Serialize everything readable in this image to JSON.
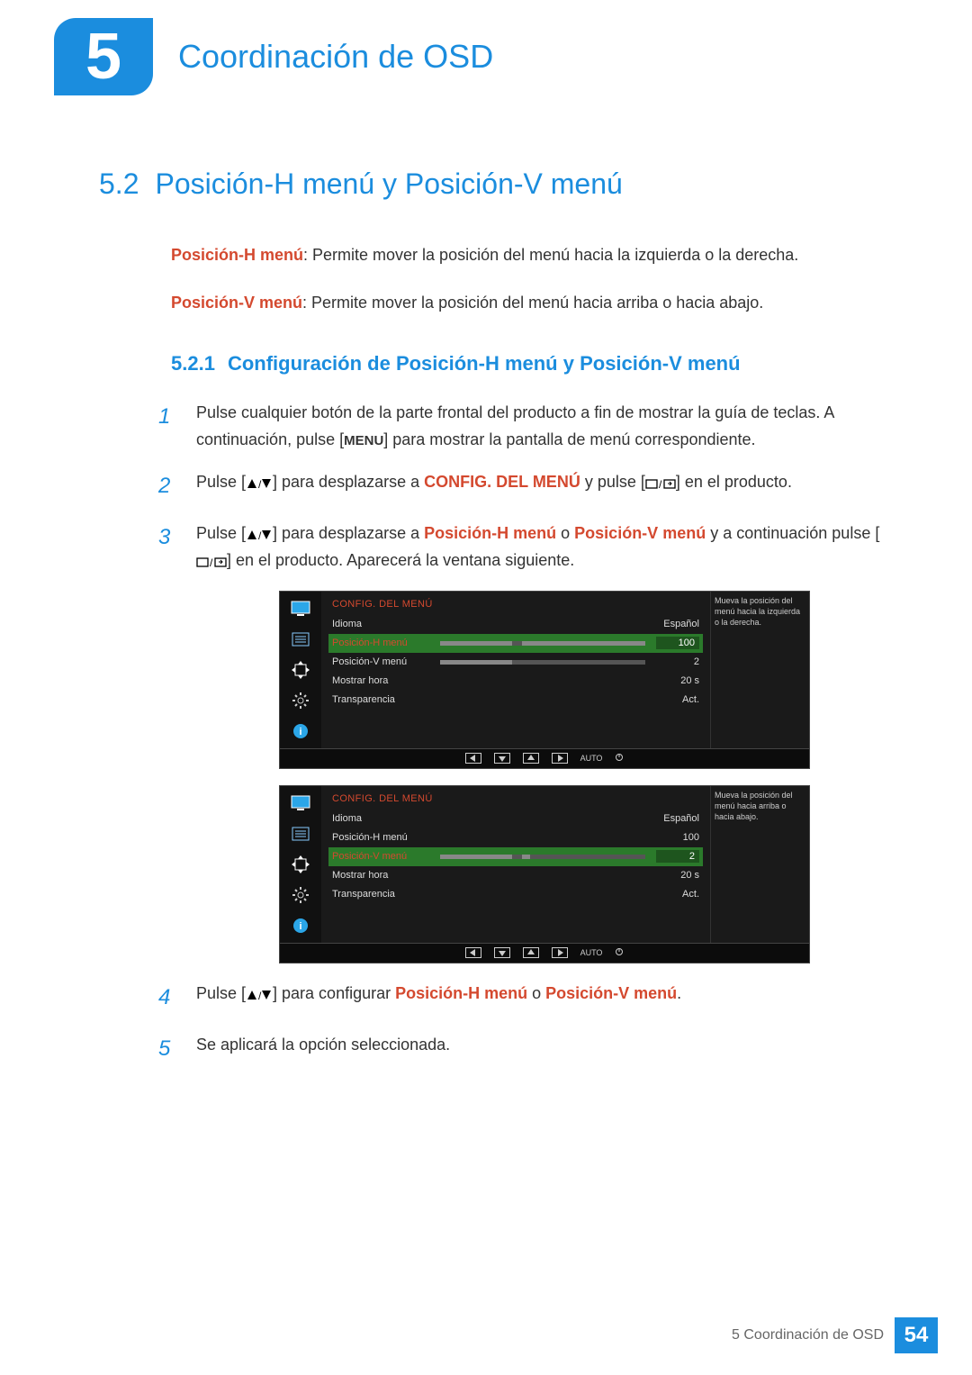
{
  "chapter": {
    "number": "5",
    "title": "Coordinación de OSD"
  },
  "section": {
    "number": "5.2",
    "title": "Posición-H menú y Posición-V menú"
  },
  "desc1_label": "Posición-H menú",
  "desc1_text": ": Permite mover la posición del menú hacia la izquierda o la derecha.",
  "desc2_label": "Posición-V menú",
  "desc2_text": ": Permite mover la posición del menú hacia arriba o hacia abajo.",
  "subsection": {
    "number": "5.2.1",
    "title": "Configuración de Posición-H menú y Posición-V menú"
  },
  "steps": {
    "s1a": "Pulse cualquier botón de la parte frontal del producto a fin de mostrar la guía de teclas. A continuación, pulse [",
    "s1menu": "MENU",
    "s1b": "] para mostrar la pantalla de menú correspondiente.",
    "s2a": "Pulse [",
    "s2b": "] para desplazarse a ",
    "s2target": "CONFIG. DEL MENÚ",
    "s2c": " y pulse [",
    "s2d": "] en el producto.",
    "s3a": "Pulse [",
    "s3b": "] para desplazarse a ",
    "s3t1": "Posición-H menú",
    "s3o": " o ",
    "s3t2": "Posición-V menú",
    "s3c": " y a continuación pulse [",
    "s3d": "] en el producto. Aparecerá la ventana siguiente.",
    "s4a": "Pulse [",
    "s4b": "] para configurar ",
    "s4t1": "Posición-H menú",
    "s4o": " o ",
    "s4t2": "Posición-V menú",
    "s4c": ".",
    "s5": "Se aplicará la opción seleccionada."
  },
  "osd": {
    "title": "CONFIG. DEL MENÚ",
    "rows": [
      {
        "label": "Idioma",
        "value": "Español",
        "bar": false
      },
      {
        "label": "Posición-H menú",
        "value": "100",
        "bar": true
      },
      {
        "label": "Posición-V menú",
        "value": "2",
        "bar": true
      },
      {
        "label": "Mostrar hora",
        "value": "20 s",
        "bar": false
      },
      {
        "label": "Transparencia",
        "value": "Act.",
        "bar": false
      }
    ],
    "hint_h": "Mueva la posición del menú hacia la izquierda o la derecha.",
    "hint_v": "Mueva la posición del menú hacia arriba o hacia abajo.",
    "footer_auto": "AUTO"
  },
  "footer": {
    "text": "5 Coordinación de OSD",
    "page": "54"
  }
}
